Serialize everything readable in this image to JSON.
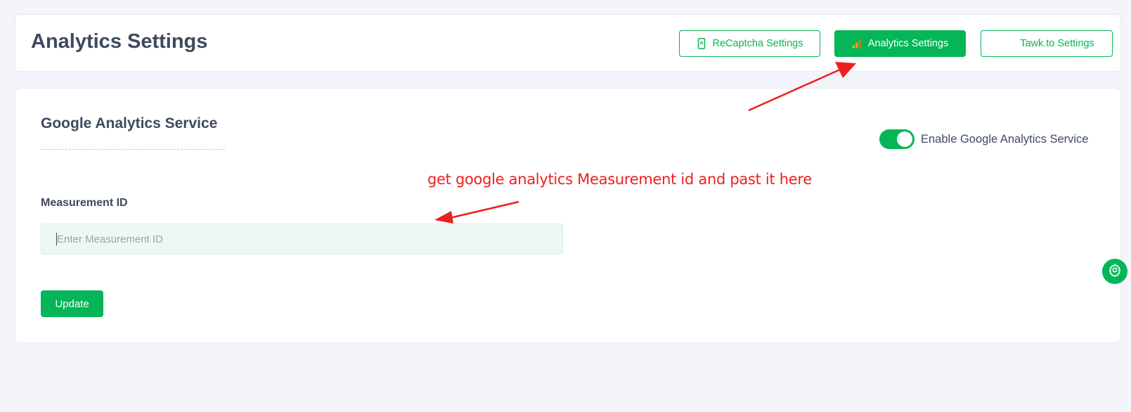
{
  "header": {
    "title": "Analytics Settings",
    "tabs": [
      {
        "label": "ReCaptcha Settings",
        "icon": "phone-shield-icon",
        "active": false
      },
      {
        "label": "Analytics Settings",
        "icon": "bar-chart-icon",
        "active": true
      },
      {
        "label": "Tawk.to Settings",
        "icon": "",
        "active": false
      }
    ]
  },
  "main": {
    "section_title": "Google Analytics Service",
    "toggle": {
      "label": "Enable Google Analytics Service",
      "enabled": true
    },
    "measurement": {
      "label": "Measurement ID",
      "value": "",
      "placeholder": "Enter Measurement ID"
    },
    "update_label": "Update"
  },
  "annotation": {
    "text": "get google analytics Measurement id and past it here"
  },
  "colors": {
    "accent": "#06b557",
    "annotation": "#ee1f1f",
    "text": "#3d4a5e",
    "background": "#f4f5fa"
  },
  "floating": {
    "icon": "gear-icon"
  }
}
